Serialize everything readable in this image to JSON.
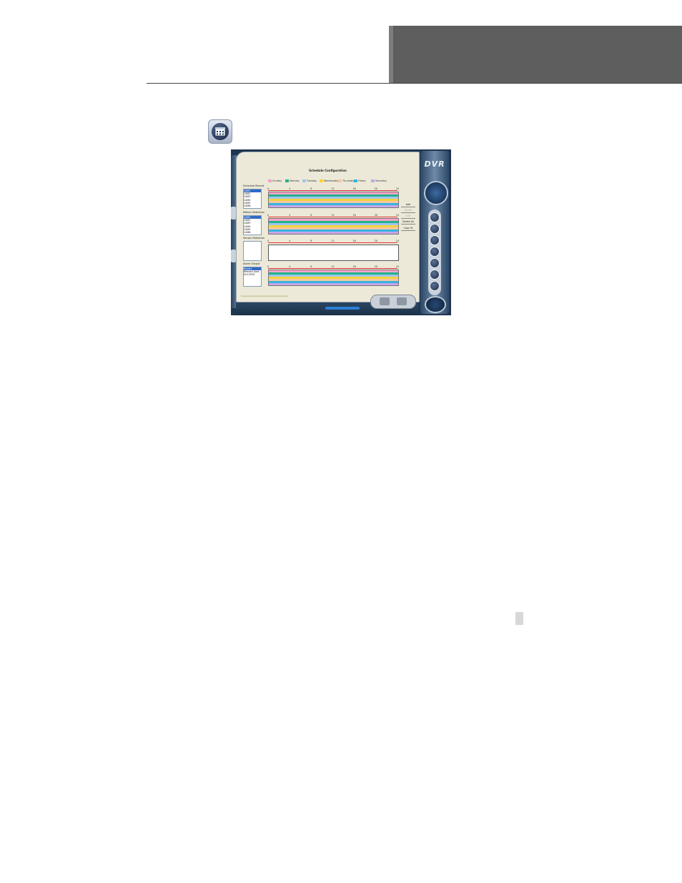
{
  "window": {
    "title": "Schedule Configuration",
    "logo": "DVR",
    "colors": {
      "frame": "#1f3650",
      "panel": "#ece9d8",
      "accent": "#2c7ed6"
    }
  },
  "legend": [
    {
      "label": "Sunday",
      "color": "#f4a3c8"
    },
    {
      "label": "Monday",
      "color": "#22b38a"
    },
    {
      "label": "Tuesday",
      "color": "#9ec6f0"
    },
    {
      "label": "Wednesday",
      "color": "#f5d23c"
    },
    {
      "label": "Thursday",
      "color": "#f6c6a0"
    },
    {
      "label": "Friday",
      "color": "#33b4e0"
    },
    {
      "label": "Saturday",
      "color": "#c9a5e8"
    }
  ],
  "ruler_labels": [
    "0",
    "4",
    "8",
    "12",
    "16",
    "20",
    "24"
  ],
  "sections": {
    "schedule_record": {
      "label": "Schedule Record",
      "items": [
        "CAM1",
        "CAM2",
        "CAM3",
        "CAM4",
        "CAM5",
        "CAM6"
      ]
    },
    "motion_detection": {
      "label": "Motion Detection",
      "items": [
        "CAM1",
        "CAM2",
        "CAM3",
        "CAM4",
        "CAM5",
        "CAM6"
      ]
    },
    "sensor_detection": {
      "label": "Sensor Detection",
      "items": []
    },
    "alarm_output": {
      "label": "Alarm Output",
      "items": [
        "Buzzer",
        "Remote Alert",
        "SUCCESS"
      ]
    }
  },
  "side_buttons": [
    {
      "label": "Add",
      "enabled": true
    },
    {
      "label": "Delete",
      "enabled": false
    },
    {
      "label": "Edit",
      "enabled": false
    },
    {
      "label": "Delete All",
      "enabled": true
    },
    {
      "label": "Copy To",
      "enabled": true
    }
  ],
  "nav_icons": [
    "home-icon",
    "record-icon",
    "camera-icon",
    "network-icon",
    "user-icon",
    "backup-icon",
    "search-icon"
  ]
}
